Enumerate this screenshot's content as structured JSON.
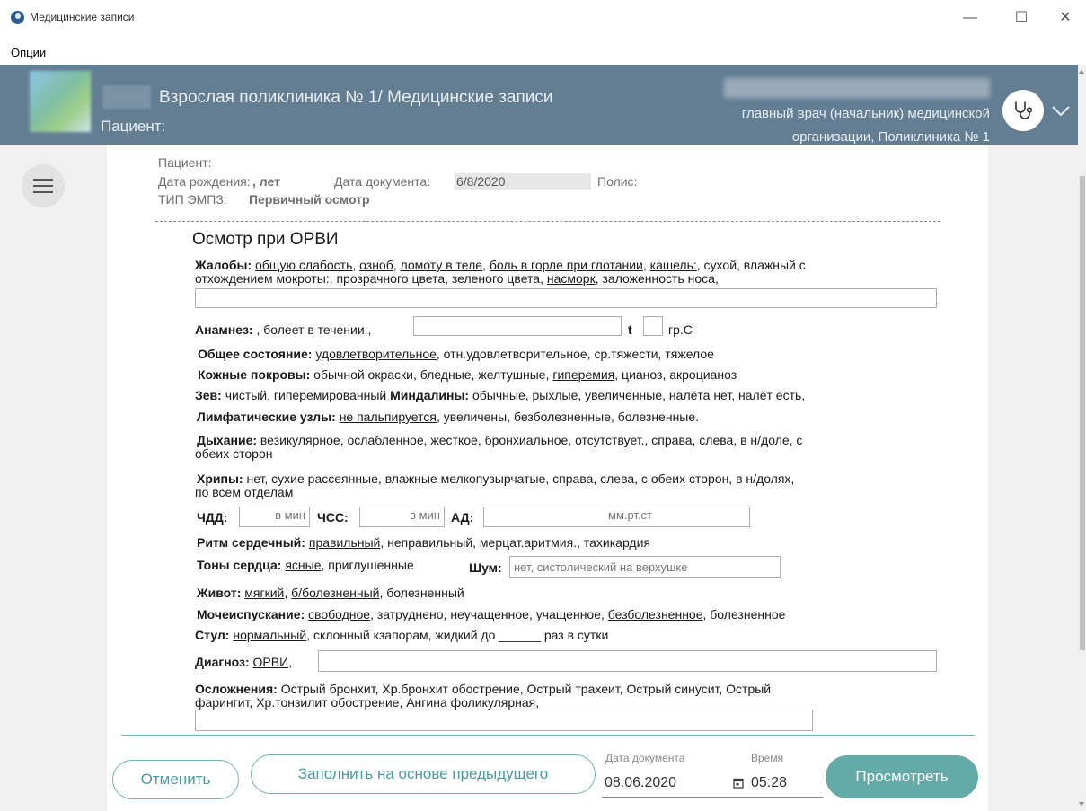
{
  "window": {
    "title": "Медицинские записи",
    "minimize": "—",
    "maximize": "☐",
    "close": "✕"
  },
  "menu": {
    "options": "Опции"
  },
  "header": {
    "clinic_title": "Взрослая поликлиника № 1/ Медицинские записи",
    "patient_label": "Пациент:",
    "doctor_position_line1": "главный врач (начальник) медицинской",
    "doctor_position_line2": "организации, Поликлиника № 1"
  },
  "doc_info": {
    "patient": "Пациент:",
    "birth_label": "Дата рождения:",
    "birth_value": ", лет",
    "doc_date_label": "Дата документа:",
    "doc_date_value": "6/8/2020",
    "policy_label": "Полис:",
    "type_label": "ТИП ЭМПЗ:",
    "type_value": "Первичный осмотр"
  },
  "form": {
    "title": "Осмотр при ОРВИ",
    "complaints": {
      "label": "Жалобы:",
      "options": [
        "общую слабость",
        "озноб",
        "ломоту в теле",
        "боль в горле при глотании",
        "кашель:"
      ],
      "rest_line1": ", сухой, влажный с",
      "line2": "отхождением мокроты:, прозрачного цвета, зеленого цвета,",
      "runny": "насморк",
      "line2_end": ", заложенность носа,"
    },
    "anamnesis": {
      "label": "Анамнез:",
      "text": ", болеет в течении:,",
      "t_label": "t",
      "unit": "гр.С"
    },
    "general": {
      "label": "Общее состояние:",
      "selected": "удовлетворительное",
      "rest": ", отн.удовлетворительное, ср.тяжести, тяжелое"
    },
    "skin": {
      "label": "Кожные покровы:",
      "pre": "обычной окраски, бледные, желтушные,",
      "selected": "гиперемия",
      "post": ", цианоз, акроцианоз"
    },
    "throat": {
      "label": "Зев:",
      "opt1": "чистый",
      "opt2": "гиперемированный",
      "tonsils_label": "Миндалины:",
      "tonsils_sel": "обычные",
      "rest": ", рыхлые, увеличенные, налёта нет, налёт есть,"
    },
    "lymph": {
      "label": "Лимфатические узлы:",
      "selected": "не пальпируется",
      "rest": ", увеличены, безболезненные, болезненные."
    },
    "breath": {
      "label": "Дыхание:",
      "line1": "везикулярное, ослабленное, жесткое, бронхиальное, отсутствует., справа, слева, в н/доле, с",
      "line2": "обеих сторон"
    },
    "rales": {
      "label": "Хрипы:",
      "line1": "нет, сухие рассеянные, влажные мелкопузырчатые, справа, слева, с обеих сторон, в н/долях,",
      "line2": "по всем отделам"
    },
    "vitals": {
      "rr_label": "ЧДД:",
      "rr_unit": "в мин",
      "hr_label": "ЧСС:",
      "hr_unit": "в мин",
      "bp_label": "АД:",
      "bp_unit": "мм.рт.ст"
    },
    "rhythm": {
      "label": "Ритм сердечный:",
      "selected": "правильный",
      "rest": ", неправильный, мерцат.аритмия., тахикардия"
    },
    "tones": {
      "label": "Тоны сердца:",
      "selected": "ясные",
      "rest": ", приглушенные",
      "noise_label": "Шум:",
      "noise_value": "нет, систолический на верхушке"
    },
    "abdomen": {
      "label": "Живот:",
      "opt1": "мягкий",
      "opt2": "б/болезненный",
      "rest": ", болезненный"
    },
    "urination": {
      "label": "Мочеиспускание:",
      "selected": "свободное",
      "mid": ", затруднено, неучащенное, учащенное,",
      "selected2": "безболезненное",
      "rest": ", болезненное"
    },
    "stool": {
      "label": "Стул:",
      "selected": "нормальный",
      "rest": ", склонный кзапорам, жидкий до ______ раз в сутки"
    },
    "diagnosis": {
      "label": "Диагноз:",
      "selected": "ОРВИ",
      "sep": ","
    },
    "complications": {
      "label": "Осложнения:",
      "line1": "Острый бронхит, Хр.бронхит обострение, Острый трахеит, Острый синусит, Острый",
      "line2": "фарингит, Хр.тонзилит обострение, Ангина фоликулярная,"
    }
  },
  "footer": {
    "cancel": "Отменить",
    "fill_prev": "Заполнить на основе предыдущего",
    "date_label": "Дата документа",
    "date_value": "08.06.2020",
    "time_label": "Время",
    "time_value": "05:28",
    "view": "Просмотреть"
  },
  "colors": {
    "header": "#637d93",
    "accent": "#64aaa8",
    "outline": "#6fb3b3"
  },
  "icons": [
    "app-icon",
    "stethoscope-icon",
    "chevron-down-icon",
    "hamburger-icon",
    "calendar-icon"
  ]
}
